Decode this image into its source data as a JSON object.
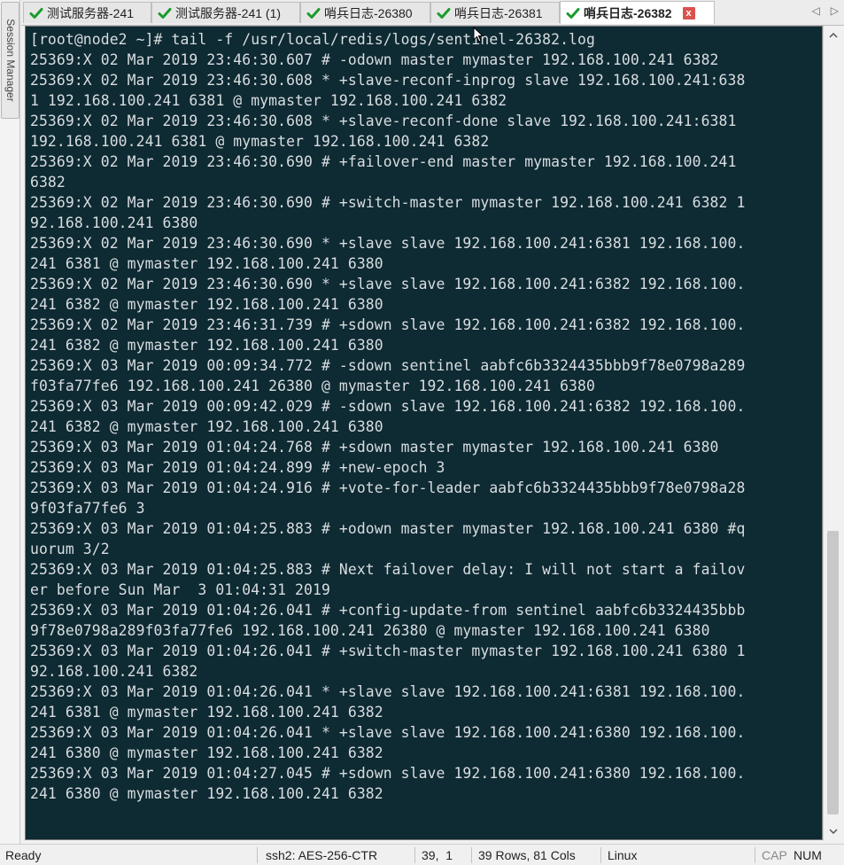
{
  "session_manager": {
    "label": "Session Manager"
  },
  "tabs": [
    {
      "label": "测试服务器-241",
      "active": false
    },
    {
      "label": "测试服务器-241 (1)",
      "active": false
    },
    {
      "label": "哨兵日志-26380",
      "active": false
    },
    {
      "label": "哨兵日志-26381",
      "active": false
    },
    {
      "label": "哨兵日志-26382",
      "active": true,
      "close": "x"
    }
  ],
  "tab_nav": {
    "prev": "◁",
    "next": "▷"
  },
  "terminal": {
    "lines": [
      "[root@node2 ~]# tail -f /usr/local/redis/logs/sentinel-26382.log",
      "25369:X 02 Mar 2019 23:46:30.607 # -odown master mymaster 192.168.100.241 6382",
      "25369:X 02 Mar 2019 23:46:30.608 * +slave-reconf-inprog slave 192.168.100.241:638",
      "1 192.168.100.241 6381 @ mymaster 192.168.100.241 6382",
      "25369:X 02 Mar 2019 23:46:30.608 * +slave-reconf-done slave 192.168.100.241:6381",
      "192.168.100.241 6381 @ mymaster 192.168.100.241 6382",
      "25369:X 02 Mar 2019 23:46:30.690 # +failover-end master mymaster 192.168.100.241",
      "6382",
      "25369:X 02 Mar 2019 23:46:30.690 # +switch-master mymaster 192.168.100.241 6382 1",
      "92.168.100.241 6380",
      "25369:X 02 Mar 2019 23:46:30.690 * +slave slave 192.168.100.241:6381 192.168.100.",
      "241 6381 @ mymaster 192.168.100.241 6380",
      "25369:X 02 Mar 2019 23:46:30.690 * +slave slave 192.168.100.241:6382 192.168.100.",
      "241 6382 @ mymaster 192.168.100.241 6380",
      "25369:X 02 Mar 2019 23:46:31.739 # +sdown slave 192.168.100.241:6382 192.168.100.",
      "241 6382 @ mymaster 192.168.100.241 6380",
      "25369:X 03 Mar 2019 00:09:34.772 # -sdown sentinel aabfc6b3324435bbb9f78e0798a289",
      "f03fa77fe6 192.168.100.241 26380 @ mymaster 192.168.100.241 6380",
      "25369:X 03 Mar 2019 00:09:42.029 # -sdown slave 192.168.100.241:6382 192.168.100.",
      "241 6382 @ mymaster 192.168.100.241 6380",
      "25369:X 03 Mar 2019 01:04:24.768 # +sdown master mymaster 192.168.100.241 6380",
      "25369:X 03 Mar 2019 01:04:24.899 # +new-epoch 3",
      "25369:X 03 Mar 2019 01:04:24.916 # +vote-for-leader aabfc6b3324435bbb9f78e0798a28",
      "9f03fa77fe6 3",
      "25369:X 03 Mar 2019 01:04:25.883 # +odown master mymaster 192.168.100.241 6380 #q",
      "uorum 3/2",
      "25369:X 03 Mar 2019 01:04:25.883 # Next failover delay: I will not start a failov",
      "er before Sun Mar  3 01:04:31 2019",
      "25369:X 03 Mar 2019 01:04:26.041 # +config-update-from sentinel aabfc6b3324435bbb",
      "9f78e0798a289f03fa77fe6 192.168.100.241 26380 @ mymaster 192.168.100.241 6380",
      "25369:X 03 Mar 2019 01:04:26.041 # +switch-master mymaster 192.168.100.241 6380 1",
      "92.168.100.241 6382",
      "25369:X 03 Mar 2019 01:04:26.041 * +slave slave 192.168.100.241:6381 192.168.100.",
      "241 6381 @ mymaster 192.168.100.241 6382",
      "25369:X 03 Mar 2019 01:04:26.041 * +slave slave 192.168.100.241:6380 192.168.100.",
      "241 6380 @ mymaster 192.168.100.241 6382",
      "25369:X 03 Mar 2019 01:04:27.045 # +sdown slave 192.168.100.241:6380 192.168.100.",
      "241 6380 @ mymaster 192.168.100.241 6382"
    ]
  },
  "scrollbar": {
    "up": "^",
    "down": "v"
  },
  "status": {
    "ready": "Ready",
    "cipher": "ssh2: AES-256-CTR",
    "cursor_pos": "39,  1",
    "size": "39 Rows, 81 Cols",
    "os": "Linux",
    "cap": "CAP",
    "num": "NUM"
  },
  "colors": {
    "terminal_bg": "#0e2a33",
    "terminal_fg": "#d8dde0",
    "check_green": "#1a9b2c",
    "close_red": "#d9534f"
  }
}
